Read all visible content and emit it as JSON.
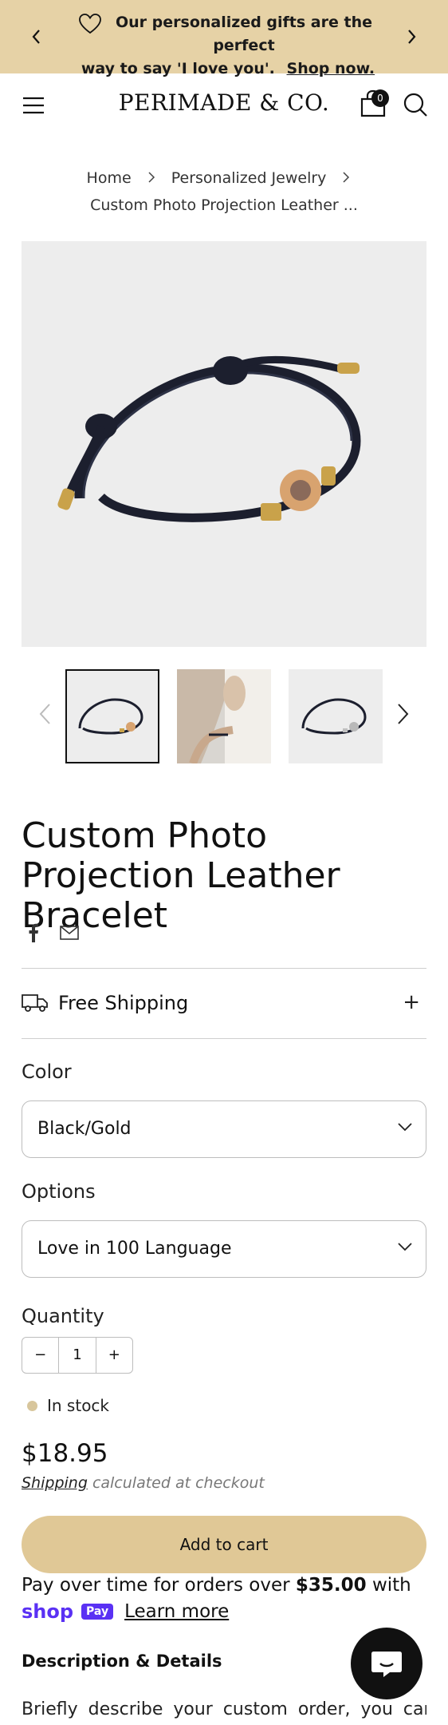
{
  "announcement": {
    "line1": "Our personalized gifts are the perfect",
    "line2": "way to say 'I love you'.",
    "link": "Shop now.",
    "icons": [
      "chevron-left-icon",
      "heart-icon",
      "chevron-right-icon"
    ]
  },
  "header": {
    "logo": "PERIMADE & CO.",
    "cart_count": "0",
    "icons": [
      "menu-icon",
      "cart-icon",
      "search-icon"
    ]
  },
  "breadcrumb": {
    "home": "Home",
    "category": "Personalized Jewelry",
    "current": "Custom Photo Projection Leather ..."
  },
  "product": {
    "title": "Custom Photo Projection Leather Bracelet",
    "shipping_label": "Free Shipping",
    "shipping_toggle": "+",
    "color_label": "Color",
    "color_value": "Black/Gold",
    "options_label": "Options",
    "options_value": "Love in 100 Language",
    "quantity_label": "Quantity",
    "quantity_minus": "−",
    "quantity_value": "1",
    "quantity_plus": "+",
    "stock_status": "In stock",
    "price": "$18.95",
    "shipping_note_link": "Shipping",
    "shipping_note_rest": "calculated at checkout",
    "add_to_cart": "Add to cart"
  },
  "installments": {
    "text_before": "Pay over time for orders over ",
    "amount": "$35.00",
    "text_after": " with",
    "shop_label": "shop",
    "pay_label": "Pay",
    "learn_more": "Learn more"
  },
  "description": {
    "title": "Description & Details",
    "body": "Briefly describe your custom order, you can"
  },
  "colors": {
    "announcement_bg": "#e6d2a6",
    "add_to_cart_bg": "#e0c896",
    "stock_dot": "#d8c69c",
    "shop_pay": "#5a31f4"
  }
}
